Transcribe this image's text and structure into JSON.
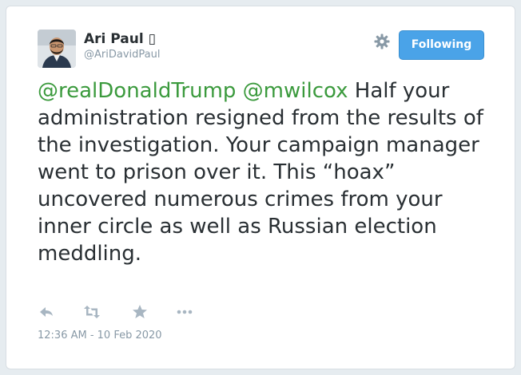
{
  "author": {
    "display_name": "Ari Paul",
    "badge_glyph": "▯",
    "handle": "@AriDavidPaul"
  },
  "header": {
    "settings_icon": "gear-icon",
    "follow_label": "Following"
  },
  "tweet": {
    "mention_1": "@realDonaldTrump",
    "space_1": " ",
    "mention_2": "@mwilcox",
    "body": " Half your administration resigned from the results of the investigation. Your campaign manager went to prison over it. This “hoax” uncovered numerous crimes from your inner circle as well as Russian election meddling."
  },
  "actions": {
    "reply_icon": "reply-icon",
    "retweet_icon": "retweet-icon",
    "favorite_icon": "star-icon",
    "more_icon": "more-dots-icon"
  },
  "meta": {
    "timestamp": "12:36 AM - 10 Feb 2020"
  },
  "colors": {
    "mention": "#3b9a3d",
    "follow_button": "#4aa3e8",
    "secondary_text": "#8899a6",
    "icon": "#a8b6c2"
  }
}
